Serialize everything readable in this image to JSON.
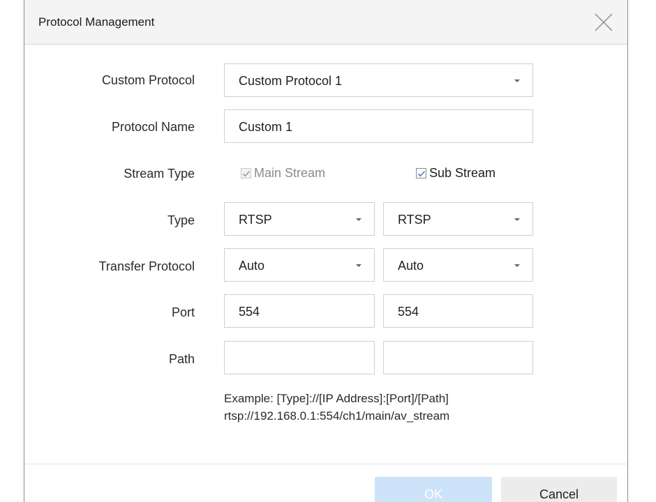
{
  "dialog": {
    "title": "Protocol Management"
  },
  "form": {
    "custom_protocol": {
      "label": "Custom Protocol",
      "value": "Custom Protocol 1"
    },
    "protocol_name": {
      "label": "Protocol Name",
      "value": "Custom 1"
    },
    "stream_type": {
      "label": "Stream Type",
      "main_stream": {
        "label": "Main Stream",
        "checked": true,
        "disabled": true
      },
      "sub_stream": {
        "label": "Sub Stream",
        "checked": true,
        "disabled": false
      }
    },
    "type": {
      "label": "Type",
      "main_value": "RTSP",
      "sub_value": "RTSP"
    },
    "transfer_protocol": {
      "label": "Transfer Protocol",
      "main_value": "Auto",
      "sub_value": "Auto"
    },
    "port": {
      "label": "Port",
      "main_value": "554",
      "sub_value": "554"
    },
    "path": {
      "label": "Path",
      "main_value": "",
      "sub_value": ""
    },
    "example": {
      "line1": "Example: [Type]://[IP Address]:[Port]/[Path]",
      "line2": "rtsp://192.168.0.1:554/ch1/main/av_stream"
    }
  },
  "footer": {
    "ok_label": "OK",
    "cancel_label": "Cancel"
  },
  "colors": {
    "ok_button": "#cde3fa",
    "cancel_button": "#ececec",
    "titlebar": "#f4f4f4"
  },
  "icons": {
    "close": "close-icon",
    "dropdown": "chevron-down-icon",
    "check": "checkmark-icon"
  }
}
